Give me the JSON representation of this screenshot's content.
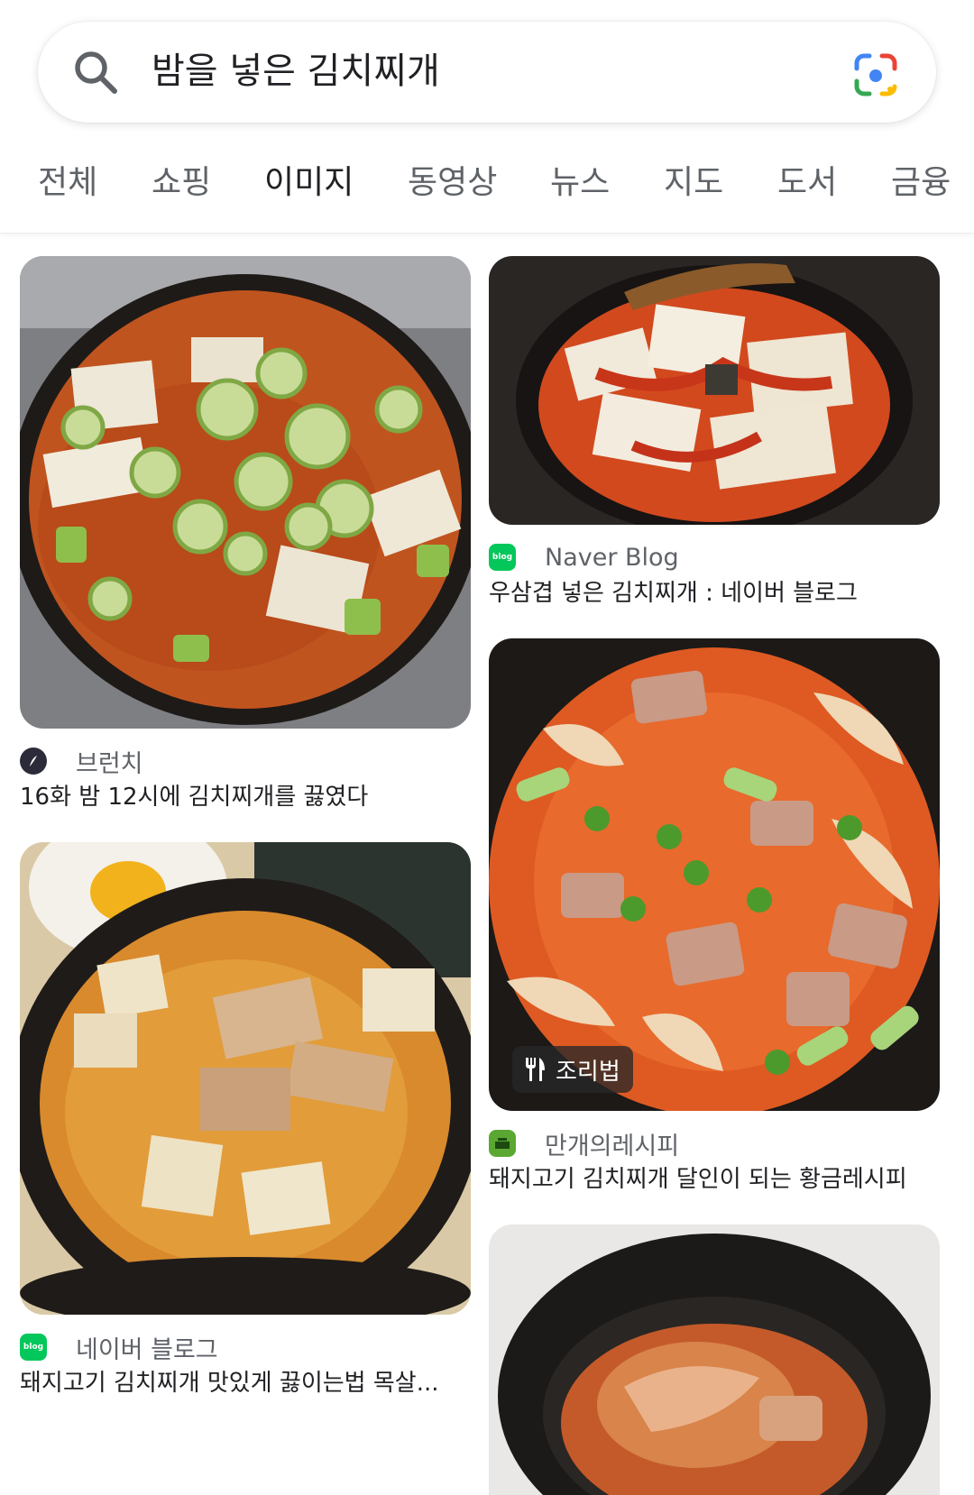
{
  "search": {
    "query": "밤을 넣은 김치찌개"
  },
  "tabs": [
    {
      "label": "전체"
    },
    {
      "label": "쇼핑"
    },
    {
      "label": "이미지",
      "active": true
    },
    {
      "label": "동영상"
    },
    {
      "label": "뉴스"
    },
    {
      "label": "지도"
    },
    {
      "label": "도서"
    },
    {
      "label": "금융"
    }
  ],
  "results": {
    "left": [
      {
        "source": "브런치",
        "source_icon": "brunch-logo-icon",
        "title": "16화 밤 12시에 김치찌개를 끓였다"
      },
      {
        "source": "네이버 블로그",
        "source_icon": "naver-blog-icon",
        "source_icon_text": "blog",
        "title": "돼지고기 김치찌개 맛있게 끓이는법 목살..."
      }
    ],
    "right": [
      {
        "source": "Naver Blog",
        "source_icon": "naver-blog-icon",
        "source_icon_text": "blog",
        "title": "우삼겹 넣은 김치찌개 : 네이버 블로그"
      },
      {
        "source": "만개의레시피",
        "source_icon": "recipe-site-icon",
        "title": "돼지고기 김치찌개 달인이 되는 황금레시피",
        "badge": "조리법",
        "badge_icon": "fork-knife-icon"
      },
      {
        "source": "",
        "title": ""
      }
    ]
  },
  "colors": {
    "naver_green": "#03c75a",
    "brunch_dark": "#2b2b3a",
    "recipe_green": "#5aa832",
    "active_tab": "#202124",
    "inactive_tab": "#5f6368"
  }
}
